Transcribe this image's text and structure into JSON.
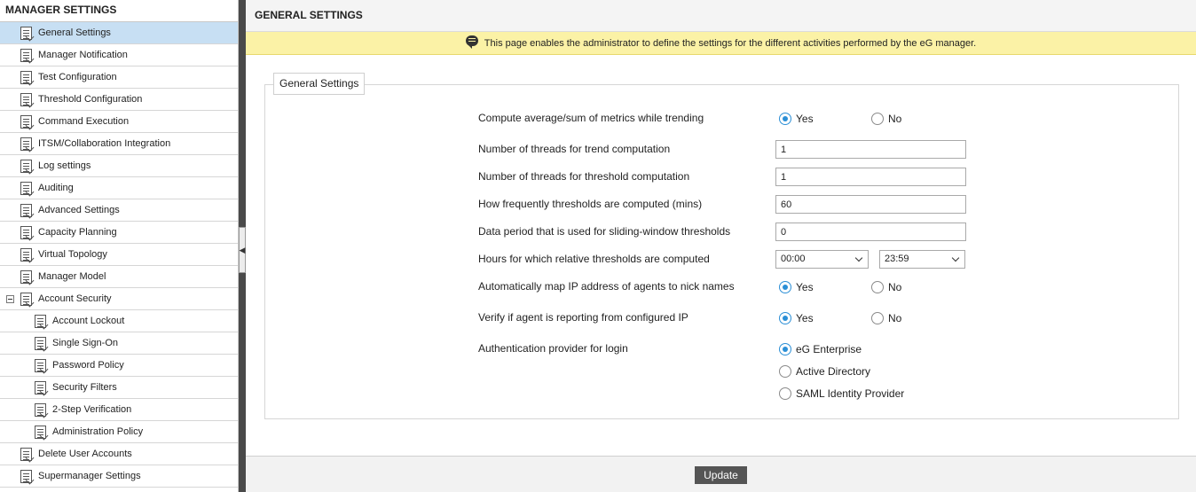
{
  "sidebar": {
    "title": "MANAGER SETTINGS",
    "items": [
      {
        "label": "General Settings",
        "level": 1,
        "active": true
      },
      {
        "label": "Manager Notification",
        "level": 1
      },
      {
        "label": "Test Configuration",
        "level": 1
      },
      {
        "label": "Threshold Configuration",
        "level": 1
      },
      {
        "label": "Command Execution",
        "level": 1
      },
      {
        "label": "ITSM/Collaboration Integration",
        "level": 1
      },
      {
        "label": "Log settings",
        "level": 1
      },
      {
        "label": "Auditing",
        "level": 1
      },
      {
        "label": "Advanced Settings",
        "level": 1
      },
      {
        "label": "Capacity Planning",
        "level": 1
      },
      {
        "label": "Virtual Topology",
        "level": 1
      },
      {
        "label": "Manager Model",
        "level": 1
      },
      {
        "label": "Account Security",
        "level": 1,
        "expanded": true
      },
      {
        "label": "Account Lockout",
        "level": 2
      },
      {
        "label": "Single Sign-On",
        "level": 2
      },
      {
        "label": "Password Policy",
        "level": 2
      },
      {
        "label": "Security Filters",
        "level": 2
      },
      {
        "label": "2-Step Verification",
        "level": 2
      },
      {
        "label": "Administration Policy",
        "level": 2
      },
      {
        "label": "Delete User Accounts",
        "level": 1
      },
      {
        "label": "Supermanager Settings",
        "level": 1
      }
    ]
  },
  "header": {
    "title": "GENERAL SETTINGS"
  },
  "banner": {
    "text": "This page enables the administrator to define the settings for the different activities performed by the eG manager."
  },
  "panel": {
    "legend": "General Settings"
  },
  "settings": {
    "trending": {
      "label": "Compute average/sum of metrics while trending",
      "yes": "Yes",
      "no": "No",
      "value": "Yes"
    },
    "trend_threads": {
      "label": "Number of threads for trend computation",
      "value": "1"
    },
    "threshold_threads": {
      "label": "Number of threads for threshold computation",
      "value": "1"
    },
    "threshold_freq": {
      "label": "How frequently thresholds are computed (mins)",
      "value": "60"
    },
    "sliding_window": {
      "label": "Data period that is used for sliding-window thresholds",
      "value": "0"
    },
    "relative_hours": {
      "label": "Hours for which relative thresholds are computed",
      "from": "00:00",
      "to": "23:59"
    },
    "map_ip": {
      "label": "Automatically map IP address of agents to nick names",
      "yes": "Yes",
      "no": "No",
      "value": "Yes"
    },
    "verify_ip": {
      "label": "Verify if agent is reporting from configured IP",
      "yes": "Yes",
      "no": "No",
      "value": "Yes"
    },
    "auth_provider": {
      "label": "Authentication provider for login",
      "options": [
        "eG Enterprise",
        "Active Directory",
        "SAML Identity Provider"
      ],
      "value": "eG Enterprise"
    }
  },
  "footer": {
    "update_label": "Update"
  },
  "colors": {
    "accent": "#2b8fd6",
    "banner_bg": "#fbf2a6",
    "active_nav": "#c7dff3",
    "button_bg": "#555555"
  }
}
